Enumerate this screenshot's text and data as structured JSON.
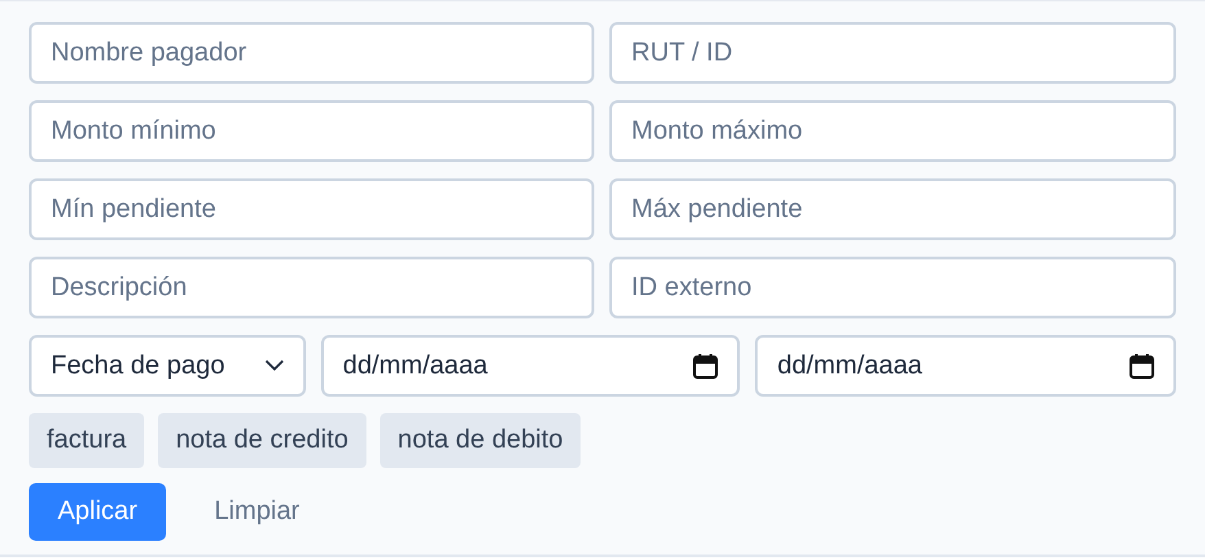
{
  "fields": [
    {
      "placeholder": "Nombre pagador"
    },
    {
      "placeholder": "RUT / ID"
    },
    {
      "placeholder": "Monto mínimo"
    },
    {
      "placeholder": "Monto máximo"
    },
    {
      "placeholder": "Mín pendiente"
    },
    {
      "placeholder": "Máx pendiente"
    },
    {
      "placeholder": "Descripción"
    },
    {
      "placeholder": "ID externo"
    }
  ],
  "date_filter": {
    "select": {
      "value": "Fecha de pago"
    },
    "from": {
      "placeholder": "dd/mm/aaaa"
    },
    "to": {
      "placeholder": "dd/mm/aaaa"
    }
  },
  "tags": [
    {
      "label": "factura",
      "selected": false
    },
    {
      "label": "nota de credito",
      "selected": false
    },
    {
      "label": "nota de debito",
      "selected": false
    }
  ],
  "buttons": [
    {
      "label": "Aplicar",
      "kind": "primary"
    },
    {
      "label": "Limpiar",
      "kind": "link"
    }
  ]
}
